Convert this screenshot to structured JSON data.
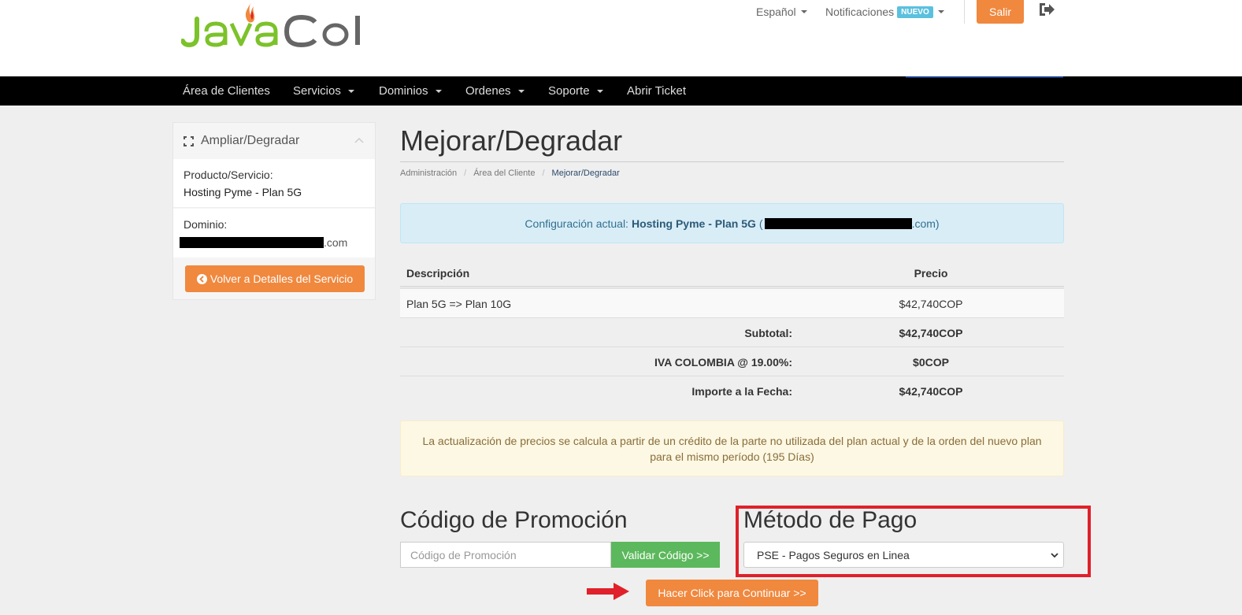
{
  "header": {
    "logo_text": "JavaCol",
    "language_label": "Español",
    "notifications_label": "Notificaciones",
    "new_badge": "NUEVO",
    "logout_button": "Salir"
  },
  "nav": {
    "items": [
      {
        "label": "Área de Clientes"
      },
      {
        "label": "Servicios"
      },
      {
        "label": "Dominios"
      },
      {
        "label": "Ordenes"
      },
      {
        "label": "Soporte"
      },
      {
        "label": "Abrir Ticket"
      }
    ]
  },
  "sidebar": {
    "title": "Ampliar/Degradar",
    "product_label": "Producto/Servicio:",
    "product_value": "Hosting Pyme - Plan 5G",
    "domain_label": "Dominio:",
    "domain_suffix": ".com",
    "back_button": "Volver a Detalles del Servicio"
  },
  "main": {
    "title": "Mejorar/Degradar",
    "breadcrumb": [
      "Administración",
      "Área del Cliente",
      "Mejorar/Degradar"
    ],
    "current_config_label": "Configuración actual:",
    "current_config_value": "Hosting Pyme - Plan 5G",
    "current_config_domain_suffix": ".com)",
    "current_config_paren_open": "(",
    "table": {
      "headers": [
        "Descripción",
        "Precio"
      ],
      "rows": [
        {
          "desc": "Plan 5G => Plan 10G",
          "price": "$42,740COP"
        }
      ],
      "summary": [
        {
          "label": "Subtotal:",
          "value": "$42,740COP"
        },
        {
          "label": "IVA COLOMBIA @ 19.00%:",
          "value": "$0COP"
        },
        {
          "label": "Importe a la Fecha:",
          "value": "$42,740COP"
        }
      ]
    },
    "notice": "La actualización de precios se calcula a partir de un crédito de la parte no utilizada del plan actual y de la orden del nuevo plan para el mismo período (195 Días)",
    "promo": {
      "heading": "Código de Promoción",
      "placeholder": "Código de Promoción",
      "button": "Validar Código >>"
    },
    "payment": {
      "heading": "Método de Pago",
      "selected": "PSE - Pagos Seguros en Linea"
    },
    "continue_button": "Hacer Click para Continuar >>"
  },
  "colors": {
    "accent_orange": "#f0883e",
    "success_green": "#5cb85c",
    "highlight_red": "#e0202a",
    "navbar_bg": "#000000"
  }
}
